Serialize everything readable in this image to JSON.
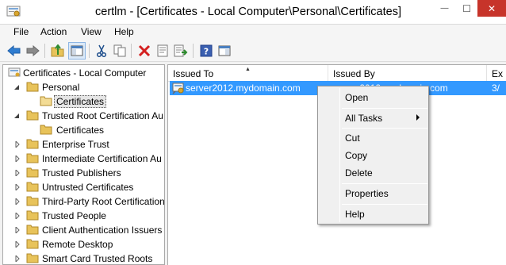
{
  "window": {
    "title": "certlm - [Certificates - Local Computer\\Personal\\Certificates]",
    "minimize_glyph": "—",
    "maximize_glyph": "☐",
    "close_glyph": "✕"
  },
  "menubar": {
    "items": [
      "File",
      "Action",
      "View",
      "Help"
    ]
  },
  "toolbar": {
    "icons": [
      "back-icon",
      "forward-icon",
      "up-folder-icon",
      "show-hide-tree-icon",
      "cut-icon",
      "copy-icon",
      "delete-icon",
      "properties-icon",
      "export-list-icon",
      "help-icon",
      "action-pane-icon"
    ]
  },
  "tree": {
    "root": "Certificates - Local Computer",
    "items": [
      {
        "label": "Personal",
        "expanded": true
      },
      {
        "label": "Certificates",
        "selected": true
      },
      {
        "label": "Trusted Root Certification Au",
        "expanded": true
      },
      {
        "label": "Certificates"
      },
      {
        "label": "Enterprise Trust"
      },
      {
        "label": "Intermediate Certification Au"
      },
      {
        "label": "Trusted Publishers"
      },
      {
        "label": "Untrusted Certificates"
      },
      {
        "label": "Third-Party Root Certification"
      },
      {
        "label": "Trusted People"
      },
      {
        "label": "Client Authentication Issuers"
      },
      {
        "label": "Remote Desktop"
      },
      {
        "label": "Smart Card Trusted Roots"
      }
    ]
  },
  "list": {
    "columns": [
      "Issued To",
      "Issued By",
      "Ex"
    ],
    "sort_glyph": "▲",
    "rows": [
      {
        "issued_to": "server2012.mydomain.com",
        "issued_by": "server2012.mydomain.com",
        "expiry": "3/"
      }
    ]
  },
  "context_menu": {
    "items": [
      "Open",
      "All Tasks",
      "Cut",
      "Copy",
      "Delete",
      "Properties",
      "Help"
    ]
  },
  "colors": {
    "selection": "#3399ff",
    "close_button": "#c7342a",
    "folder": "#e8c35a"
  }
}
